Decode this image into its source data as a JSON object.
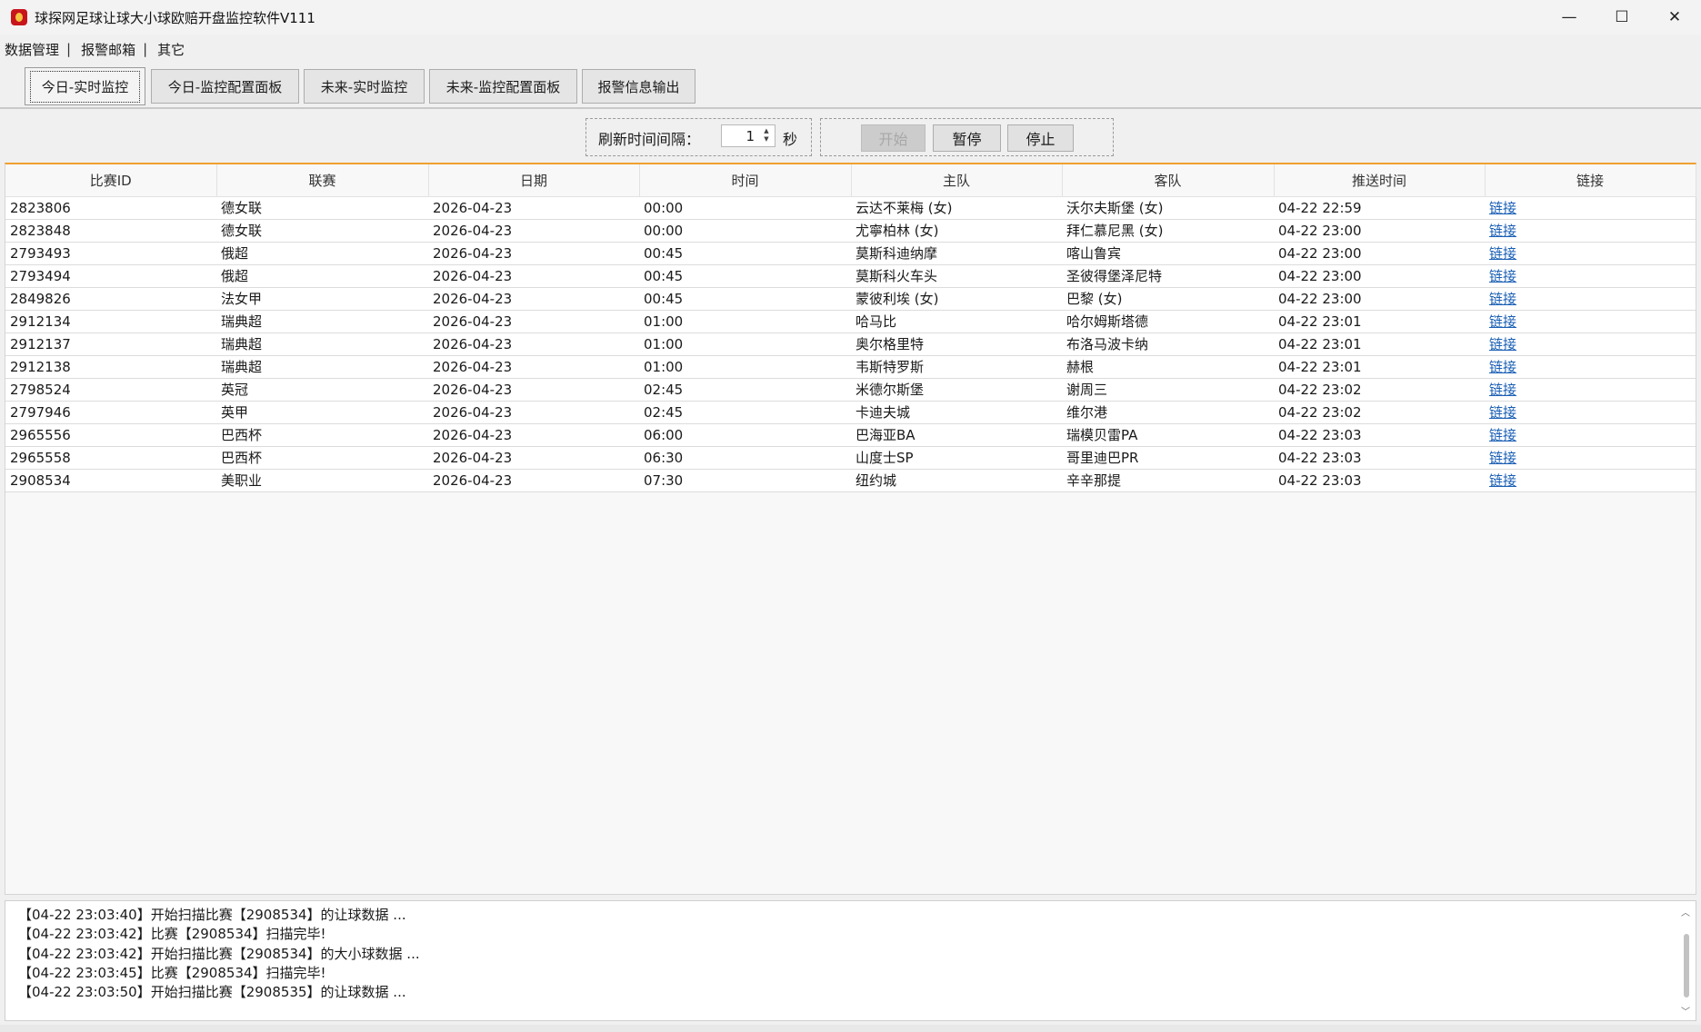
{
  "window": {
    "title": "球探网足球让球大小球欧赔开盘监控软件V111",
    "minimize": "—",
    "maximize": "☐",
    "close": "✕"
  },
  "menu": {
    "items": [
      "数据管理",
      "报警邮箱",
      "其它"
    ],
    "separator": "|"
  },
  "tabs": [
    {
      "label": "今日-实时监控",
      "active": true
    },
    {
      "label": "今日-监控配置面板",
      "active": false
    },
    {
      "label": "未来-实时监控",
      "active": false
    },
    {
      "label": "未来-监控配置面板",
      "active": false
    },
    {
      "label": "报警信息输出",
      "active": false
    }
  ],
  "controls": {
    "interval_label": "刷新时间间隔：",
    "interval_value": "1",
    "unit_label": "秒",
    "start_label": "开始",
    "pause_label": "暂停",
    "stop_label": "停止"
  },
  "table": {
    "columns": [
      "比赛ID",
      "联赛",
      "日期",
      "时间",
      "主队",
      "客队",
      "推送时间",
      "链接"
    ],
    "rows": [
      [
        "2823806",
        "德女联",
        "2026-04-23",
        "00:00",
        "云达不莱梅 (女)",
        "沃尔夫斯堡 (女)",
        "04-22 22:59",
        "链接"
      ],
      [
        "2823848",
        "德女联",
        "2026-04-23",
        "00:00",
        "尤寧柏林 (女)",
        "拜仁慕尼黑 (女)",
        "04-22 23:00",
        "链接"
      ],
      [
        "2793493",
        "俄超",
        "2026-04-23",
        "00:45",
        "莫斯科迪纳摩",
        "喀山鲁宾",
        "04-22 23:00",
        "链接"
      ],
      [
        "2793494",
        "俄超",
        "2026-04-23",
        "00:45",
        "莫斯科火车头",
        "圣彼得堡泽尼特",
        "04-22 23:00",
        "链接"
      ],
      [
        "2849826",
        "法女甲",
        "2026-04-23",
        "00:45",
        "蒙彼利埃 (女)",
        "巴黎 (女)",
        "04-22 23:00",
        "链接"
      ],
      [
        "2912134",
        "瑞典超",
        "2026-04-23",
        "01:00",
        "哈马比",
        "哈尔姆斯塔德",
        "04-22 23:01",
        "链接"
      ],
      [
        "2912137",
        "瑞典超",
        "2026-04-23",
        "01:00",
        "奥尔格里特",
        "布洛马波卡纳",
        "04-22 23:01",
        "链接"
      ],
      [
        "2912138",
        "瑞典超",
        "2026-04-23",
        "01:00",
        "韦斯特罗斯",
        "赫根",
        "04-22 23:01",
        "链接"
      ],
      [
        "2798524",
        "英冠",
        "2026-04-23",
        "02:45",
        "米德尔斯堡",
        "谢周三",
        "04-22 23:02",
        "链接"
      ],
      [
        "2797946",
        "英甲",
        "2026-04-23",
        "02:45",
        "卡迪夫城",
        "维尔港",
        "04-22 23:02",
        "链接"
      ],
      [
        "2965556",
        "巴西杯",
        "2026-04-23",
        "06:00",
        "巴海亚BA",
        "瑞模贝雷PA",
        "04-22 23:03",
        "链接"
      ],
      [
        "2965558",
        "巴西杯",
        "2026-04-23",
        "06:30",
        "山度士SP",
        "哥里迪巴PR",
        "04-22 23:03",
        "链接"
      ],
      [
        "2908534",
        "美职业",
        "2026-04-23",
        "07:30",
        "纽约城",
        "辛辛那提",
        "04-22 23:03",
        "链接"
      ]
    ]
  },
  "log": [
    "【04-22 23:03:40】开始扫描比赛【2908534】的让球数据 ...",
    "【04-22 23:03:42】比赛【2908534】扫描完毕!",
    "【04-22 23:03:42】开始扫描比赛【2908534】的大小球数据 ...",
    "【04-22 23:03:45】比赛【2908534】扫描完毕!",
    "【04-22 23:03:50】开始扫描比赛【2908535】的让球数据 ..."
  ],
  "colors": {
    "accent_line": "#f0a030",
    "link": "#1a5fb4",
    "app_icon": "#c8151b"
  }
}
